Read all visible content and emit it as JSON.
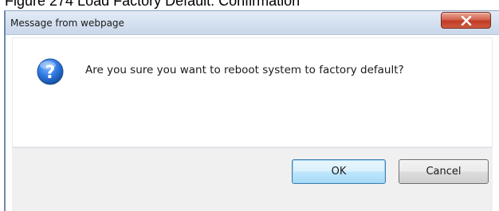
{
  "caption": "Figure 274   Load Factory Default: Confirmation",
  "dialog": {
    "title": "Message from webpage",
    "message": "Are you sure you want to reboot system to factory default?",
    "ok_label": "OK",
    "cancel_label": "Cancel",
    "close_label": "X"
  },
  "icons": {
    "close": "close-icon",
    "question": "question-icon"
  },
  "colors": {
    "close_button": "#c13a23",
    "question_icon": "#1f5fb5",
    "ok_button_border": "#3c7fb1",
    "footer_background": "#f0f0f0"
  }
}
